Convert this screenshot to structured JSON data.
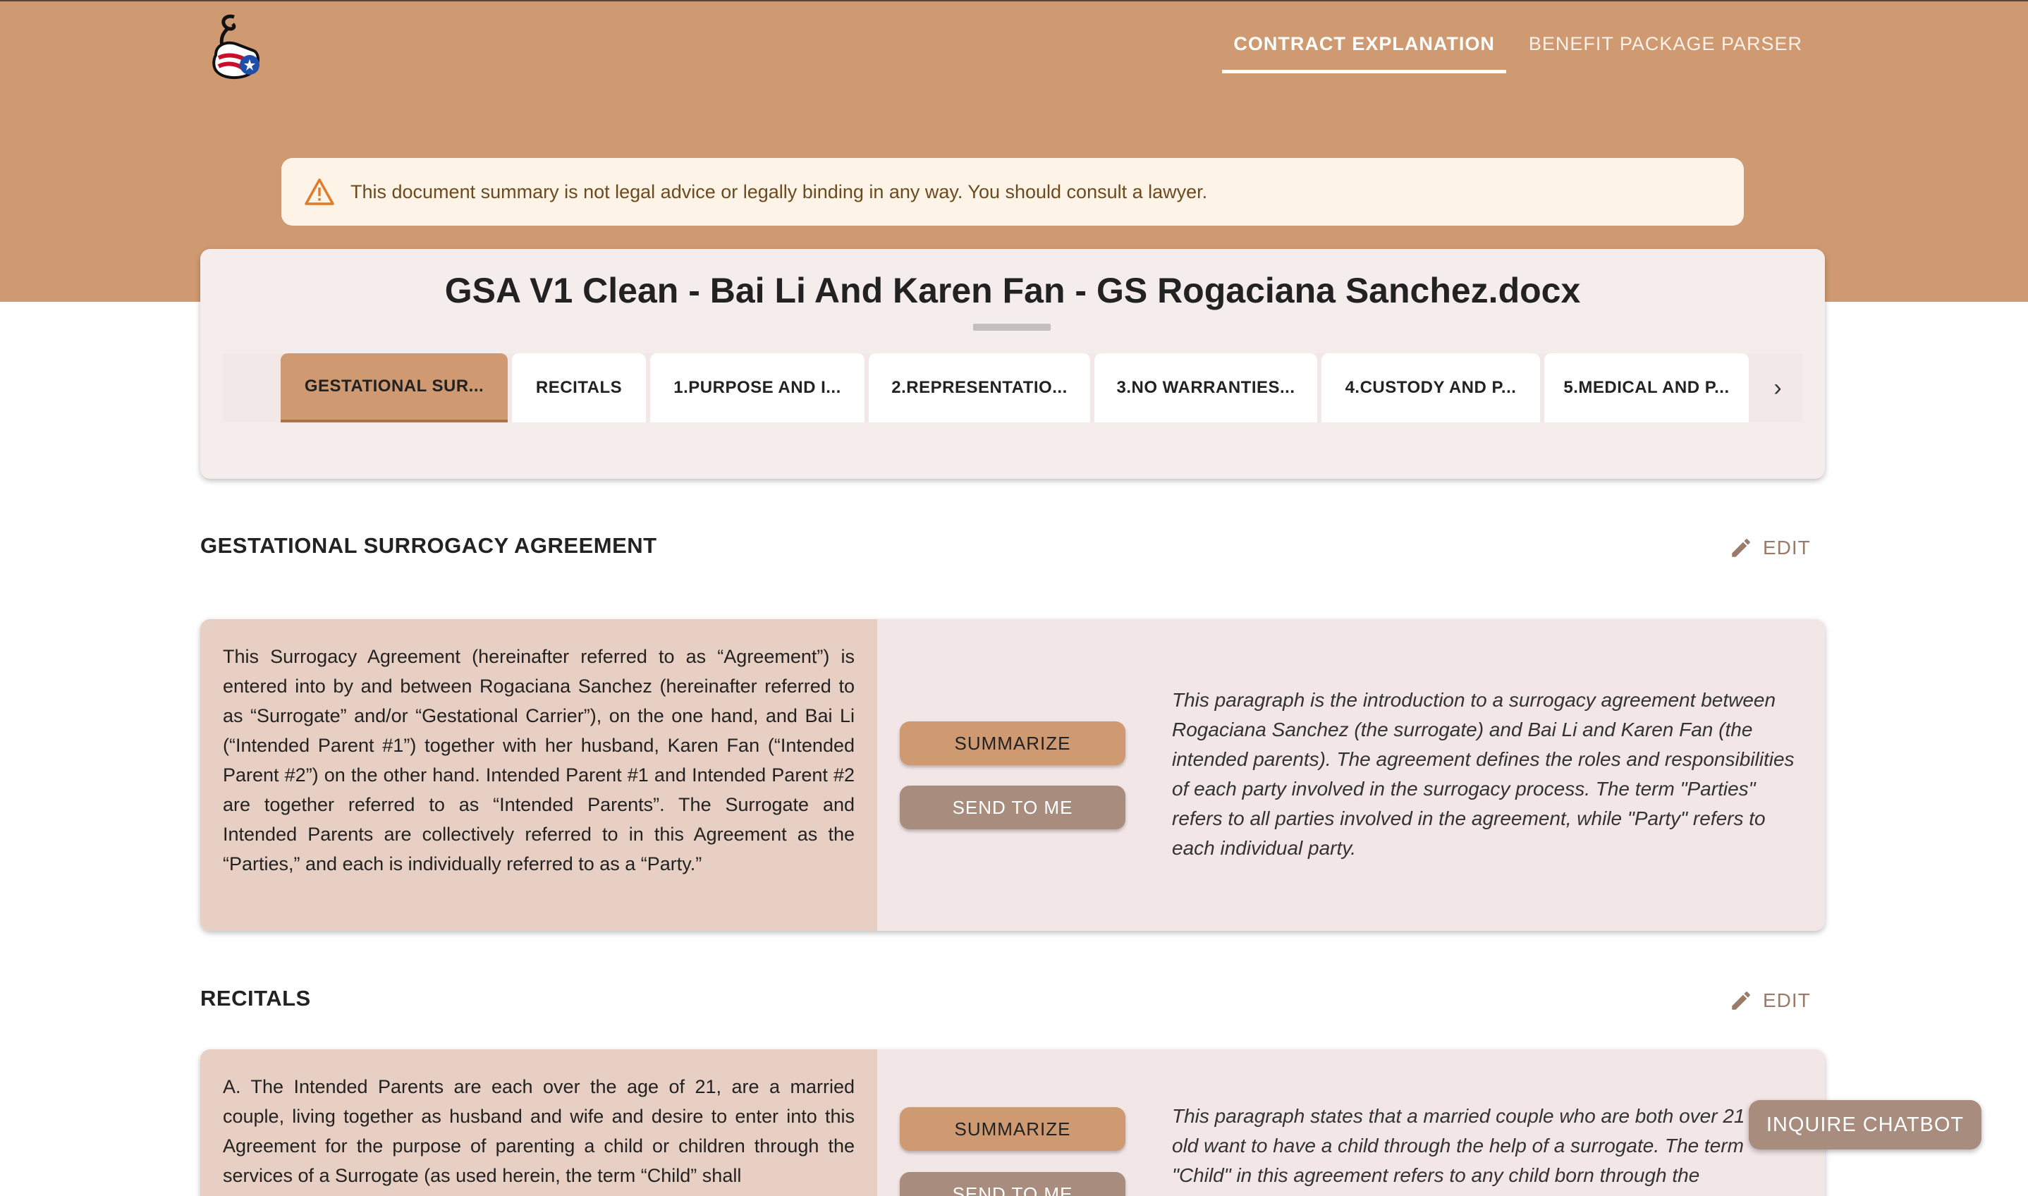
{
  "nav": {
    "tabs": [
      {
        "label": "CONTRACT EXPLANATION",
        "active": true
      },
      {
        "label": "BENEFIT PACKAGE PARSER",
        "active": false
      }
    ]
  },
  "disclaimer": {
    "icon": "warning-triangle-icon",
    "text": "This document summary is not legal advice or legally binding in any way. You should consult a lawyer."
  },
  "document": {
    "title": "GSA V1 Clean - Bai Li And Karen Fan - GS Rogaciana Sanchez.docx",
    "tabs": [
      {
        "label": "GESTATIONAL SUR...",
        "active": true
      },
      {
        "label": "RECITALS",
        "active": false
      },
      {
        "label": "1.PURPOSE AND I...",
        "active": false
      },
      {
        "label": "2.REPRESENTATIO...",
        "active": false
      },
      {
        "label": "3.NO WARRANTIES...",
        "active": false
      },
      {
        "label": "4.CUSTODY AND P...",
        "active": false
      },
      {
        "label": "5.MEDICAL AND P...",
        "active": false
      }
    ],
    "scroll_icon": "›"
  },
  "sections": [
    {
      "heading": "GESTATIONAL SURROGACY AGREEMENT",
      "edit_label": "EDIT",
      "original": "This Surrogacy Agreement (hereinafter referred to as “Agreement”) is entered into by and between Rogaciana Sanchez (hereinafter referred to as “Surrogate” and/or “Gestational Carrier”), on the one hand, and Bai Li (“Intended Parent #1”) together with her husband, Karen Fan (“Intended Parent #2”) on the other hand. Intended Parent #1 and Intended Parent #2 are together referred to as “Intended Parents”. The Surrogate and Intended Parents are collectively referred to in this Agreement as the “Parties,” and each is individually referred to as a “Party.”",
      "summarize_label": "SUMMARIZE",
      "send_label": "SEND TO ME",
      "summary": "This paragraph is the introduction to a surrogacy agreement between Rogaciana Sanchez (the surrogate) and Bai Li and Karen Fan (the intended parents). The agreement defines the roles and responsibilities of each party involved in the surrogacy process. The term \"Parties\" refers to all parties involved in the agreement, while \"Party\" refers to each individual party."
    },
    {
      "heading": "RECITALS",
      "edit_label": "EDIT",
      "original": "A. The Intended Parents are each over the age of 21, are a married couple, living together as husband and wife and desire to enter into this Agreement for the purpose of parenting a child or children through the services of a Surrogate (as used herein, the term “Child” shall",
      "summarize_label": "SUMMARIZE",
      "send_label": "SEND TO ME",
      "summary": "This paragraph states that a married couple who are both over 21 years old want to have a child through the help of a surrogate. The term \"Child\" in this agreement refers to any child born through the"
    }
  ],
  "chatbot": {
    "label": "INQUIRE CHATBOT"
  }
}
